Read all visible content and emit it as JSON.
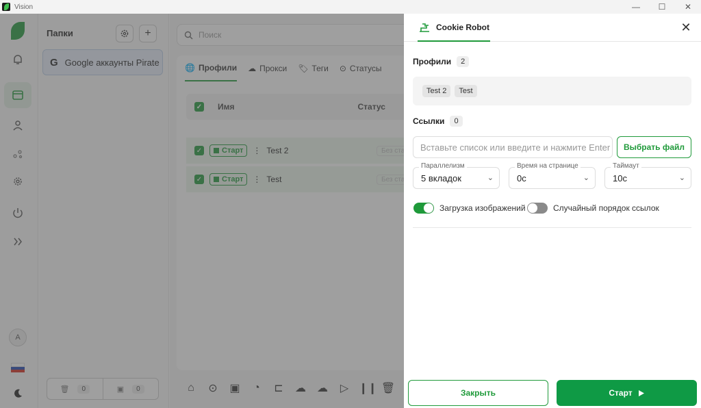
{
  "window": {
    "title": "Vision",
    "controls": [
      "—",
      "☐",
      "✕"
    ]
  },
  "rail": {
    "avatar_letter": "A"
  },
  "folders": {
    "title": "Папки",
    "items": [
      {
        "label": "Google аккаунты Pirate"
      }
    ],
    "trash_count": "0",
    "archive_count": "0"
  },
  "main": {
    "search_placeholder": "Поиск",
    "tabs": [
      {
        "label": "Профили"
      },
      {
        "label": "Прокси"
      },
      {
        "label": "Теги"
      },
      {
        "label": "Статусы"
      }
    ],
    "table": {
      "headers": {
        "name": "Имя",
        "status": "Статус"
      },
      "start_label": "Старт",
      "rows": [
        {
          "name": "Test 2",
          "status": "Без статуса"
        },
        {
          "name": "Test",
          "status": "Без статуса"
        }
      ]
    }
  },
  "drawer": {
    "tab_label": "Cookie Robot",
    "profiles_label": "Профили",
    "profiles_count": "2",
    "profiles": [
      "Test 2",
      "Test"
    ],
    "links_label": "Ссылки",
    "links_count": "0",
    "links_placeholder": "Вставьте список или введите и нажмите Enter",
    "choose_file_label": "Выбрать файл",
    "selects": {
      "parallelism": {
        "label": "Параллелизм",
        "value": "5 вкладок"
      },
      "time_on_page": {
        "label": "Время на странице",
        "value": "0с"
      },
      "timeout": {
        "label": "Таймаут",
        "value": "10с"
      }
    },
    "toggles": {
      "load_images": {
        "label": "Загрузка изображений",
        "on": true
      },
      "random_order": {
        "label": "Случайный порядок ссылок",
        "on": false
      }
    },
    "close_label": "Закрыть",
    "start_label": "Старт"
  },
  "colors": {
    "accent": "#1f9a3a",
    "start_button": "#0f9a45"
  }
}
